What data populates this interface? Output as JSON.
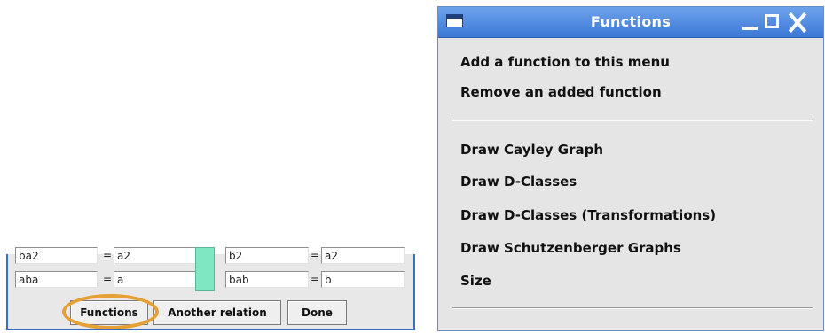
{
  "relations": {
    "rows": [
      {
        "lhs1": "ba2",
        "rhs1": "a2",
        "lhs2": "b2",
        "rhs2": "a2"
      },
      {
        "lhs1": "aba",
        "rhs1": "a",
        "lhs2": "bab",
        "rhs2": "b"
      }
    ],
    "equals": "=",
    "buttons": {
      "functions": "Functions",
      "another_relation": "Another relation",
      "done": "Done"
    },
    "highlight_color": "#e6a034",
    "separator_color": "#7fe7c2"
  },
  "popup": {
    "title": "Functions",
    "menu_group_1": [
      "Add a function to this menu",
      "Remove an added function"
    ],
    "menu_group_2": [
      "Draw Cayley Graph",
      "Draw D-Classes",
      "Draw D-Classes (Transformations)",
      "Draw Schutzenberger Graphs",
      "Size"
    ],
    "titlebar_color": "#3b78d6"
  }
}
